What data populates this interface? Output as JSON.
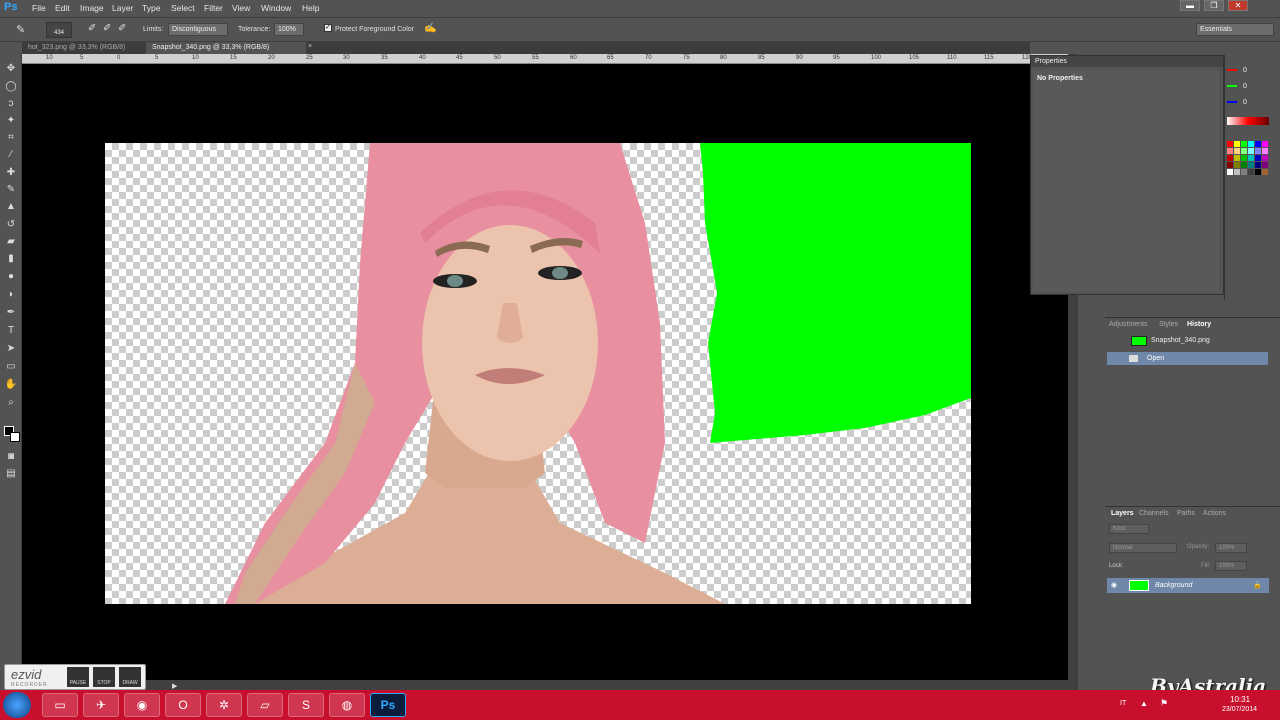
{
  "menubar": {
    "logo": "Ps",
    "items": [
      "File",
      "Edit",
      "Image",
      "Layer",
      "Type",
      "Select",
      "Filter",
      "View",
      "Window",
      "Help"
    ]
  },
  "options": {
    "brush_size": "434",
    "limits_label": "Limits:",
    "limits_value": "Discontiguous",
    "tolerance_label": "Tolerance:",
    "tolerance_value": "100%",
    "protect_label": "Protect Foreground Color",
    "workspace": "Essentials"
  },
  "tabs": [
    {
      "label": "hot_323.png @ 33,3% (RGB/8)",
      "active": false
    },
    {
      "label": "Snapshot_340.png @ 33,3% (RGB/8)",
      "active": true
    }
  ],
  "ruler_ticks": [
    "10",
    "5",
    "0",
    "5",
    "10",
    "15",
    "20",
    "25",
    "30",
    "35",
    "40",
    "45",
    "50",
    "55",
    "60",
    "65",
    "70",
    "75",
    "80",
    "85",
    "90",
    "95",
    "100",
    "105",
    "110",
    "115",
    "120"
  ],
  "properties": {
    "title": "Properties",
    "body": "No Properties"
  },
  "color": {
    "r": "0",
    "g": "0",
    "b": "0",
    "swatches": [
      "#ff0000",
      "#ffff00",
      "#00ff00",
      "#00ffff",
      "#0000ff",
      "#ff00ff",
      "#ff8080",
      "#ffd080",
      "#80ff80",
      "#80ffff",
      "#8080ff",
      "#ff80ff",
      "#c00000",
      "#c0c000",
      "#00c000",
      "#00c0c0",
      "#0000c0",
      "#c000c0",
      "#800000",
      "#808000",
      "#008000",
      "#008080",
      "#000080",
      "#800080",
      "#ffffff",
      "#c0c0c0",
      "#808080",
      "#404040",
      "#000000",
      "#a06030"
    ]
  },
  "history": {
    "tabs": [
      "Adjustments",
      "Styles",
      "History"
    ],
    "snapshot": "Snapshot_340.png",
    "items": [
      "Open"
    ]
  },
  "layers": {
    "tabs": [
      "Layers",
      "Channels",
      "Paths",
      "Actions"
    ],
    "kind": "Kind",
    "blend": "Normal",
    "opacity_label": "Opacity:",
    "opacity_value": "100%",
    "lock_label": "Lock:",
    "fill_label": "Fill:",
    "fill_value": "100%",
    "layer_name": "Background"
  },
  "ezvid": {
    "logo": "ezvid",
    "sub": "RECORDER",
    "pause": "PAUSE",
    "stop": "STOP",
    "draw": "DRAW"
  },
  "taskbar": {
    "lang": "IT",
    "time": "10:31",
    "date": "23/07/2014"
  },
  "watermark": "ByAstralia",
  "colors": {
    "canvas_green": "#00ff00",
    "hair_pink": "#e88fa0",
    "skin": "#e6b9a2",
    "taskbar": "#c8102e"
  }
}
